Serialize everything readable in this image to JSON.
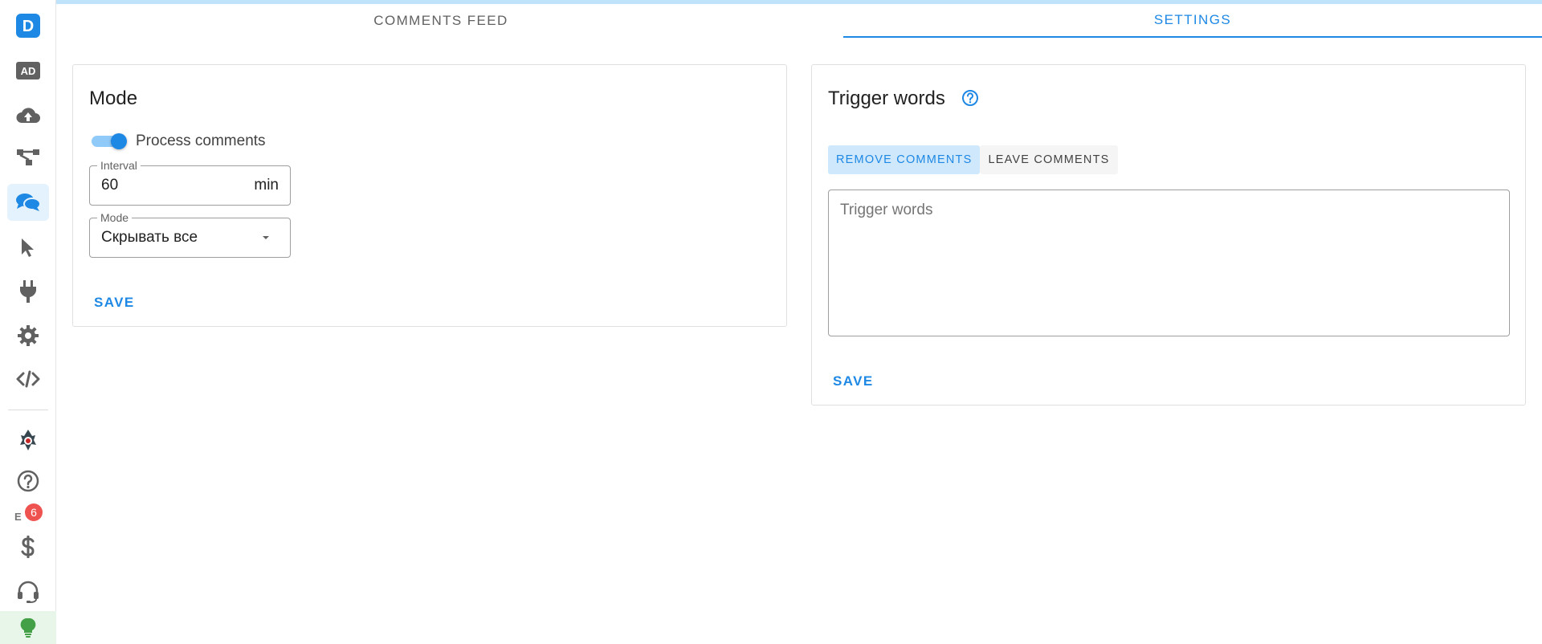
{
  "sidebar": {
    "logo_letter": "D",
    "badge_count": "6",
    "items": [
      {
        "icon": "logo-icon"
      },
      {
        "icon": "ad-icon",
        "label": "AD"
      },
      {
        "icon": "cloud-upload-icon"
      },
      {
        "icon": "hierarchy-icon"
      },
      {
        "icon": "comments-icon",
        "active": true
      },
      {
        "icon": "cursor-icon"
      },
      {
        "icon": "plug-icon"
      },
      {
        "icon": "gear-icon"
      },
      {
        "icon": "code-icon"
      },
      {
        "icon": "avatar-icon"
      },
      {
        "icon": "help-icon"
      },
      {
        "icon": "notification-icon"
      },
      {
        "icon": "dollar-icon"
      },
      {
        "icon": "headset-icon"
      },
      {
        "icon": "lightbulb-icon"
      }
    ],
    "colors": {
      "icon": "#616161",
      "active_bg": "#e3f2fd",
      "active_icon": "#1e88e5",
      "logo_bg": "#1e88e5",
      "bulb": "#43a047"
    }
  },
  "tabs": [
    {
      "label": "COMMENTS FEED",
      "active": false
    },
    {
      "label": "SETTINGS",
      "active": true
    }
  ],
  "mode_card": {
    "title": "Mode",
    "toggle": {
      "label": "Process comments",
      "on": true
    },
    "interval": {
      "legend": "Interval",
      "value": "60",
      "suffix": "min"
    },
    "mode_select": {
      "legend": "Mode",
      "value": "Скрывать все"
    },
    "save_label": "SAVE"
  },
  "trigger_card": {
    "title": "Trigger words",
    "buttons": [
      {
        "label": "REMOVE COMMENTS",
        "active": true
      },
      {
        "label": "LEAVE COMMENTS",
        "active": false
      }
    ],
    "textarea_placeholder": "Trigger words",
    "save_label": "SAVE"
  },
  "colors": {
    "accent": "#1e88e5",
    "toggle_track": "#90caf9"
  }
}
